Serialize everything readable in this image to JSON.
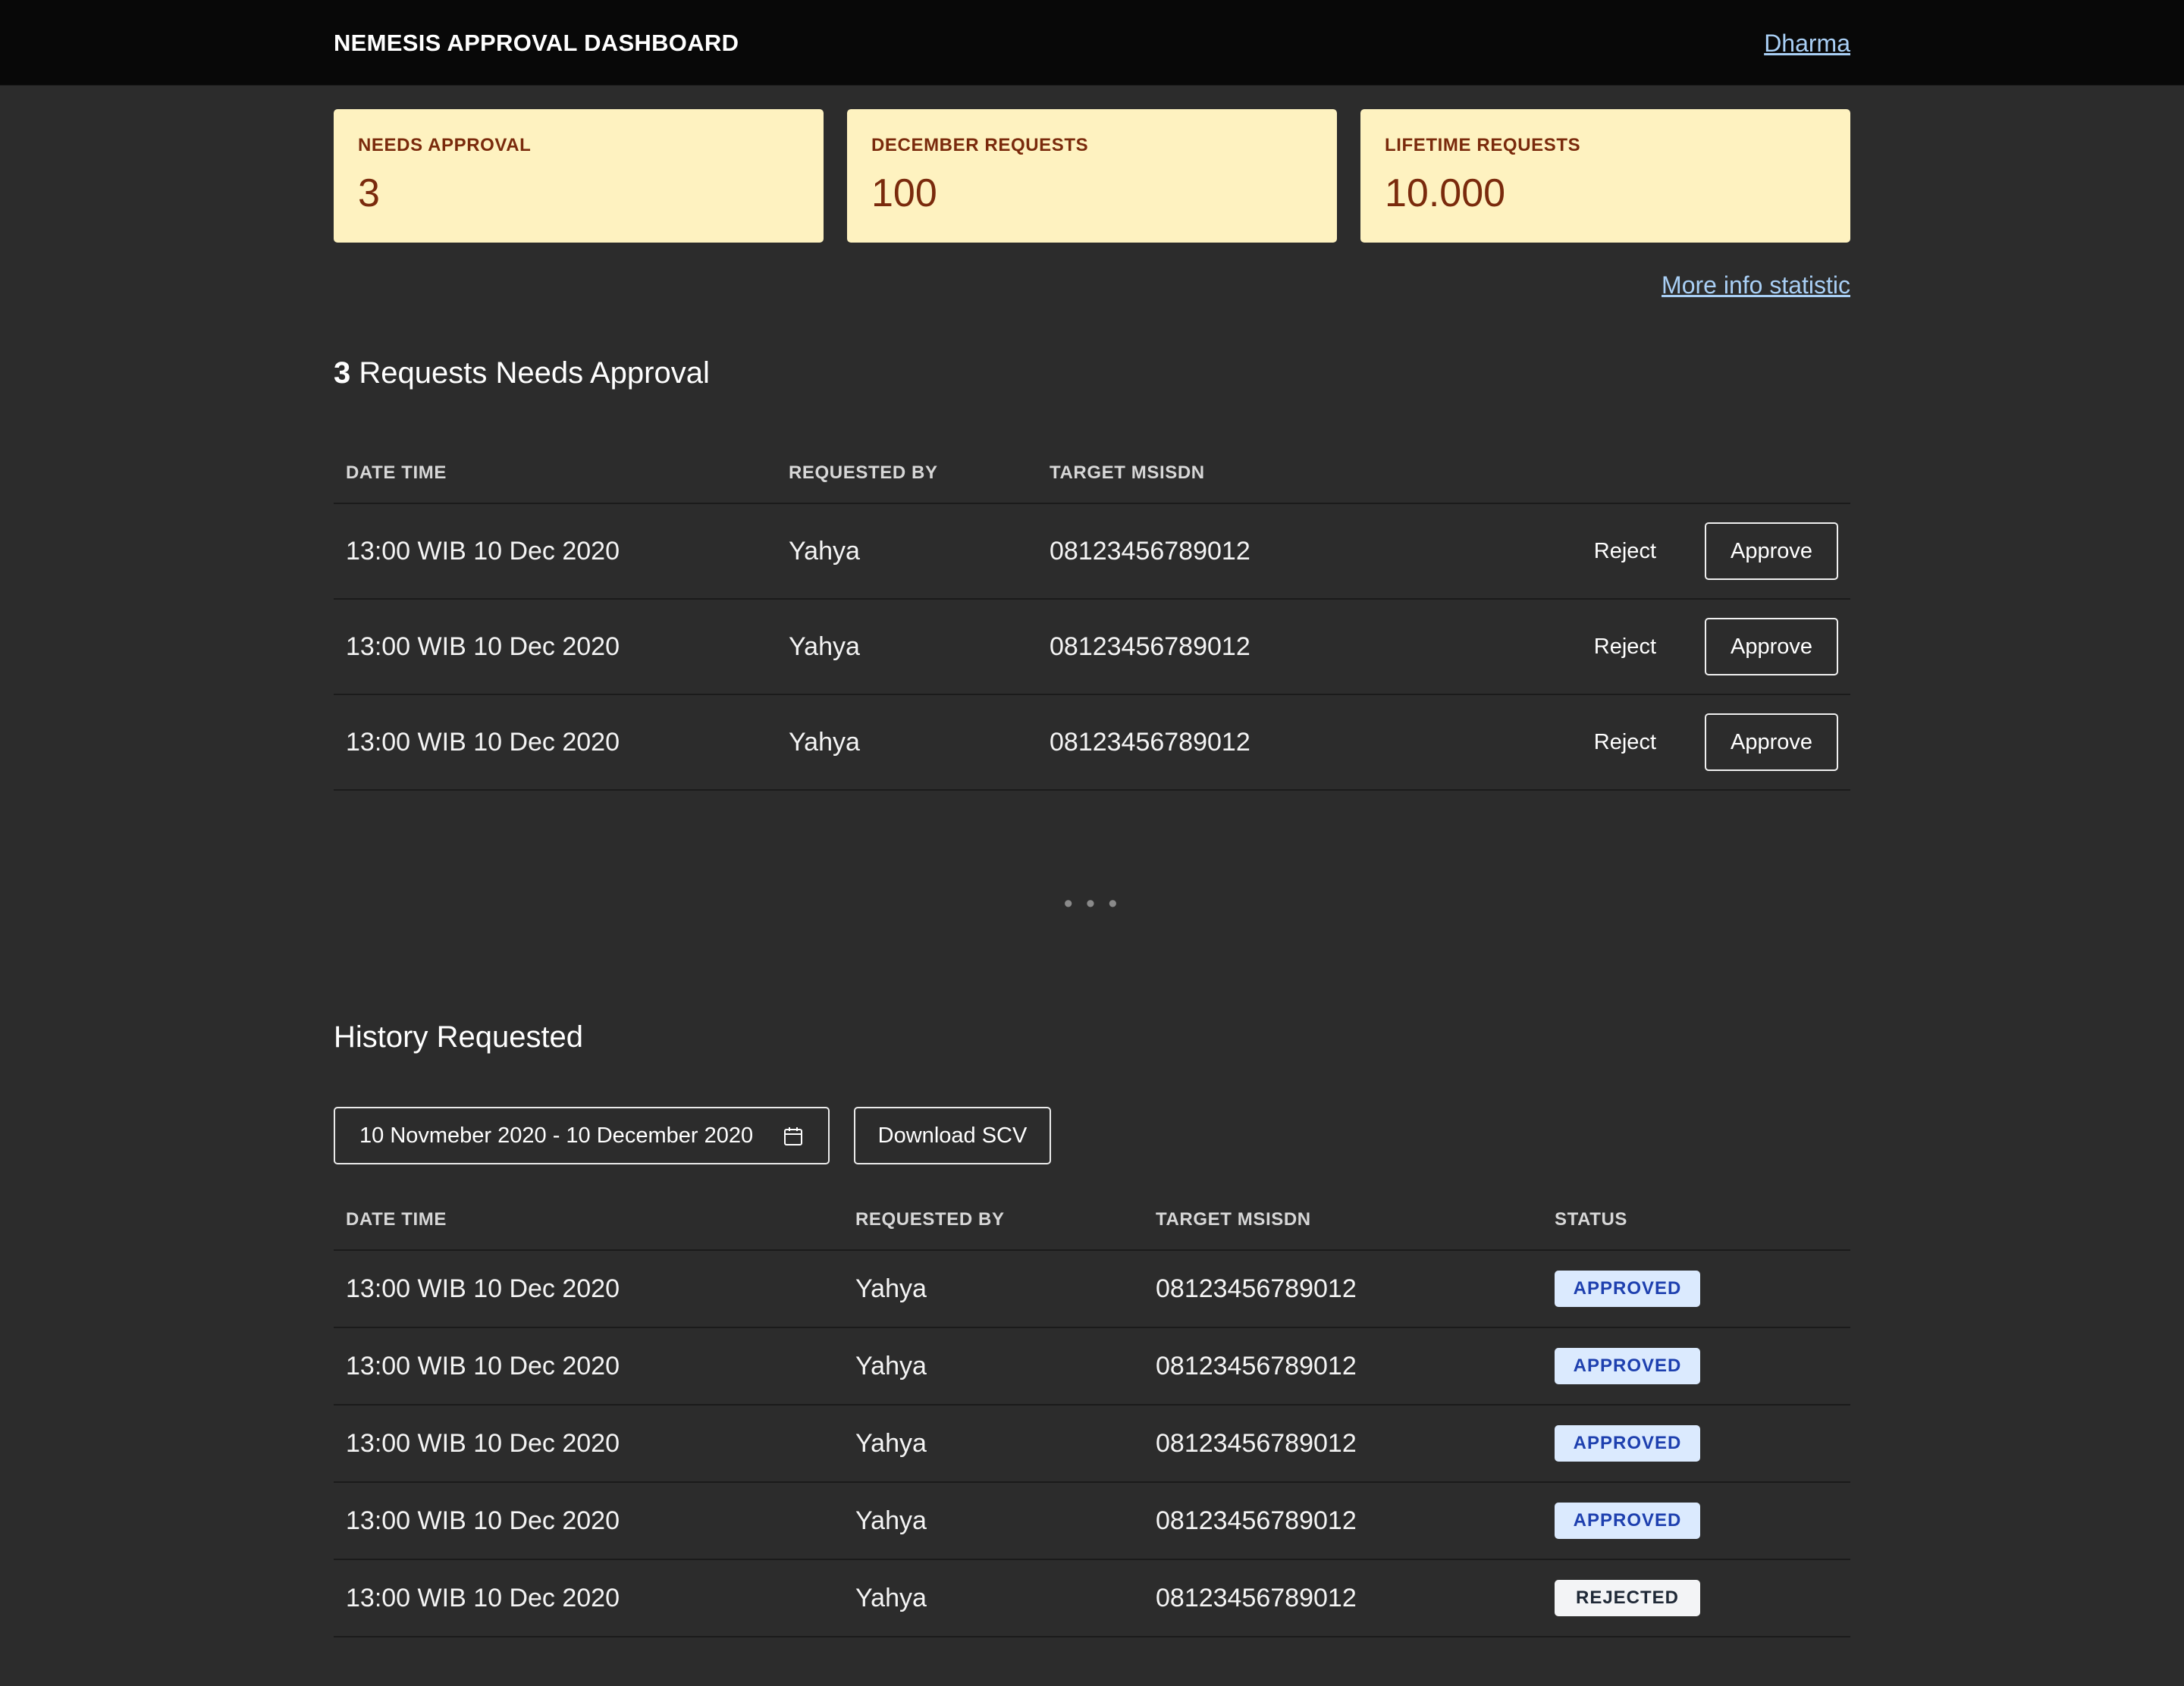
{
  "header": {
    "title": "NEMESIS APPROVAL DASHBOARD",
    "user": "Dharma"
  },
  "stats": [
    {
      "label": "NEEDS APPROVAL",
      "value": "3"
    },
    {
      "label": "DECEMBER REQUESTS",
      "value": "100"
    },
    {
      "label": "LIFETIME REQUESTS",
      "value": "10.000"
    }
  ],
  "more_info_link": "More info statistic",
  "pending": {
    "count": "3",
    "title_suffix": "Requests Needs Approval",
    "columns": [
      "DATE TIME",
      "REQUESTED BY",
      "TARGET MSISDN"
    ],
    "reject_label": "Reject",
    "approve_label": "Approve",
    "rows": [
      {
        "datetime": "13:00 WIB 10 Dec 2020",
        "requested_by": "Yahya",
        "msisdn": "08123456789012"
      },
      {
        "datetime": "13:00 WIB 10 Dec 2020",
        "requested_by": "Yahya",
        "msisdn": "08123456789012"
      },
      {
        "datetime": "13:00 WIB 10 Dec 2020",
        "requested_by": "Yahya",
        "msisdn": "08123456789012"
      }
    ]
  },
  "ellipsis": "• • •",
  "history": {
    "title": "History Requested",
    "date_range": "10 Novmeber 2020 - 10 December 2020",
    "download_label": "Download SCV",
    "columns": [
      "DATE TIME",
      "REQUESTED BY",
      "TARGET MSISDN",
      "STATUS"
    ],
    "rows": [
      {
        "datetime": "13:00 WIB 10 Dec 2020",
        "requested_by": "Yahya",
        "msisdn": "08123456789012",
        "status": "APPROVED"
      },
      {
        "datetime": "13:00 WIB 10 Dec 2020",
        "requested_by": "Yahya",
        "msisdn": "08123456789012",
        "status": "APPROVED"
      },
      {
        "datetime": "13:00 WIB 10 Dec 2020",
        "requested_by": "Yahya",
        "msisdn": "08123456789012",
        "status": "APPROVED"
      },
      {
        "datetime": "13:00 WIB 10 Dec 2020",
        "requested_by": "Yahya",
        "msisdn": "08123456789012",
        "status": "APPROVED"
      },
      {
        "datetime": "13:00 WIB 10 Dec 2020",
        "requested_by": "Yahya",
        "msisdn": "08123456789012",
        "status": "REJECTED"
      }
    ]
  },
  "colors": {
    "background": "#2c2c2c",
    "topbar": "#080808",
    "card_bg": "#fef2c0",
    "card_text": "#7a2a0c",
    "link": "#a9cff5",
    "approved_bg": "#dbeafe",
    "approved_text": "#1e40af",
    "rejected_bg": "#f3f4f6",
    "rejected_text": "#1f2937"
  }
}
